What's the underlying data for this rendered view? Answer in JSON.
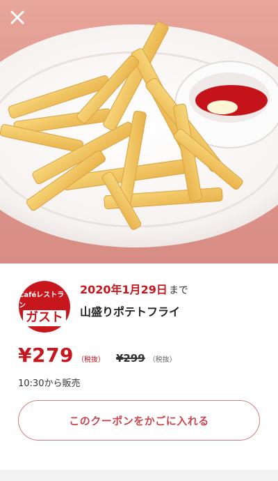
{
  "hero": {
    "image_subject": "fries-with-ketchup-mayo-photo"
  },
  "close_button": {
    "icon": "close-icon"
  },
  "brand_logo": {
    "top_text": "Caféレストラン",
    "main_text": "ガスト",
    "color": "#c8161d"
  },
  "coupon": {
    "deadline_date": "2020年1月29日",
    "deadline_suffix": "まで",
    "product_name": "山盛りポテトフライ",
    "price_current": "¥279",
    "tax_note_current": "（税抜）",
    "price_original": "¥299",
    "tax_note_original": "（税抜）",
    "sale_time": "10:30から販売"
  },
  "actions": {
    "add_to_cart_label": "このクーポンをかごに入れる"
  },
  "colors": {
    "accent_red": "#c8161d",
    "button_border": "#d37b7f",
    "background_pink": "#dd978c"
  }
}
